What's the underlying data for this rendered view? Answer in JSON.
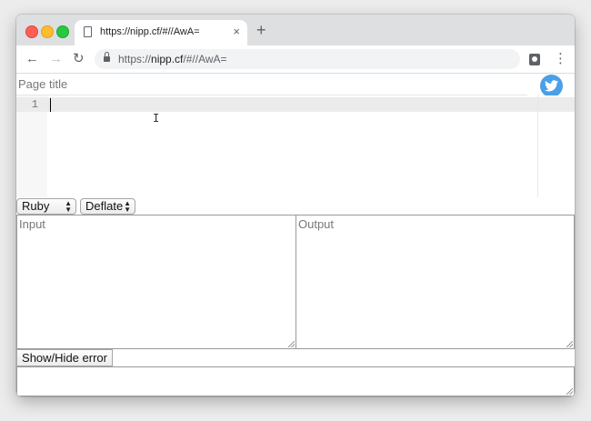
{
  "browser": {
    "tab_title": "https://nipp.cf/#//AwA=",
    "tab_close": "×",
    "new_tab": "+",
    "url_scheme": "https://",
    "url_host": "nipp.cf",
    "url_path": "/#//AwA=",
    "back": "←",
    "forward": "→",
    "reload": "↻",
    "menu": "⋮"
  },
  "page": {
    "title_placeholder": "Page title",
    "editor": {
      "line_numbers": [
        "1"
      ],
      "content": ""
    },
    "language_select": {
      "selected": "Ruby"
    },
    "compression_select": {
      "selected": "Deflate"
    },
    "input_placeholder": "Input",
    "output_placeholder": "Output",
    "toggle_error_label": "Show/Hide error"
  },
  "colors": {
    "twitter_blue": "#4a9fe8",
    "active_line": "#ebebeb"
  }
}
